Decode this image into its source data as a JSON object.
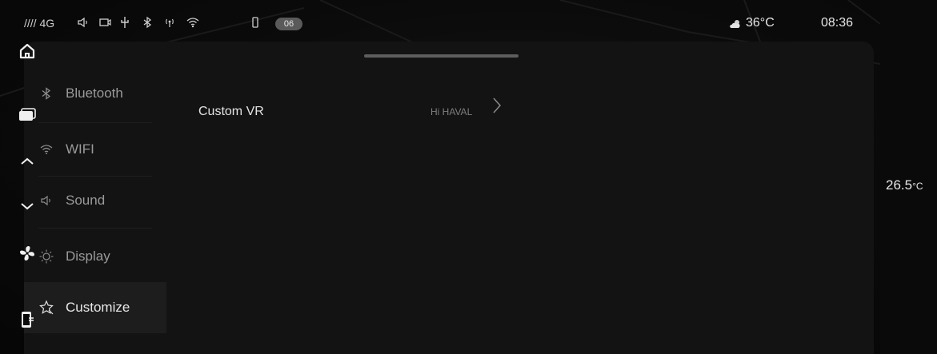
{
  "status_bar": {
    "signal": "//// 4G",
    "badge": "06",
    "outside_temp": "36°C",
    "time": "08:36",
    "icons": [
      "volume-icon",
      "camera-icon",
      "usb-icon",
      "bluetooth-icon",
      "hotspot-icon",
      "wifi-icon",
      "battery-icon"
    ]
  },
  "sidebar": {
    "items": [
      {
        "label": "Bluetooth",
        "icon": "bluetooth-icon"
      },
      {
        "label": "WIFI",
        "icon": "wifi-icon"
      },
      {
        "label": "Sound",
        "icon": "sound-icon"
      },
      {
        "label": "Display",
        "icon": "brightness-icon"
      },
      {
        "label": "Customize",
        "icon": "customize-icon",
        "active": true
      }
    ]
  },
  "content": {
    "custom_vr_label": "Custom VR",
    "custom_vr_value": "Hi HAVAL"
  },
  "dock": {
    "cabin_temp": "26.5",
    "cabin_temp_unit": "°C",
    "buttons": [
      "home-icon",
      "screens-icon",
      "temp-up-icon",
      "temp-down-icon",
      "fan-icon",
      "phone-mirror-icon"
    ]
  },
  "colors": {
    "background": "#070707",
    "panel": "#131313",
    "active_item": "#1d1d1d",
    "text_primary": "#e4e4e4",
    "text_secondary": "#9a9a9a"
  }
}
